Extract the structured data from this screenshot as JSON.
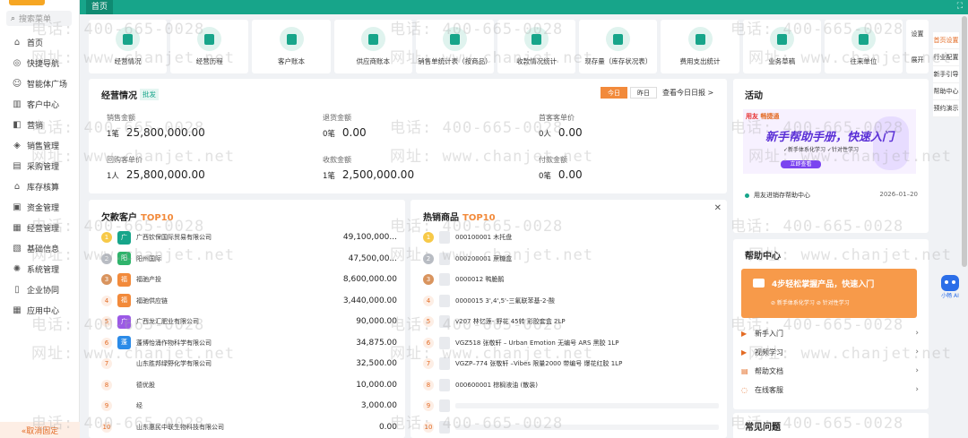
{
  "sidebar": {
    "search_placeholder": "搜索菜单",
    "items": [
      {
        "label": "首页",
        "icon": "home-icon"
      },
      {
        "label": "快捷导航",
        "icon": "compass-icon"
      },
      {
        "label": "智能体广场",
        "icon": "robot-icon"
      },
      {
        "label": "客户中心",
        "icon": "book-icon"
      },
      {
        "label": "营销",
        "icon": "megaphone-icon"
      },
      {
        "label": "销售管理",
        "icon": "tag-icon"
      },
      {
        "label": "采购管理",
        "icon": "cart-icon"
      },
      {
        "label": "库存核算",
        "icon": "warehouse-icon"
      },
      {
        "label": "资金管理",
        "icon": "wallet-icon"
      },
      {
        "label": "经营管理",
        "icon": "chart-icon"
      },
      {
        "label": "基础信息",
        "icon": "id-card-icon"
      },
      {
        "label": "系统管理",
        "icon": "gear-icon"
      },
      {
        "label": "企业协同",
        "icon": "doc-icon"
      },
      {
        "label": "应用中心",
        "icon": "calendar-icon"
      }
    ],
    "cancel_fix": "«取消固定"
  },
  "topbar": {
    "tab_home": "首页",
    "fullscreen_icon": "expand-icon"
  },
  "tiles": [
    "经营情况",
    "经营历程",
    "客户账本",
    "供应商账本",
    "销售单统计表（按商品）",
    "收款情况统计",
    "现存量（库存状况表）",
    "费用支出统计",
    "业务草稿",
    "往来单位"
  ],
  "tile_side": {
    "settings": "设置",
    "expand": "展开"
  },
  "rail": [
    "首页设置",
    "行业配置",
    "新手引导",
    "帮助中心",
    "预约演示"
  ],
  "assistant": "小畅 AI",
  "business": {
    "title": "经营情况",
    "tag": "批发",
    "btn_today": "今日",
    "btn_yesterday": "昨日",
    "link": "查看今日日报 >",
    "stats": [
      {
        "key": "销售金额",
        "count": "1笔",
        "value": "25,800,000.00"
      },
      {
        "key": "退货金额",
        "count": "0笔",
        "value": "0.00"
      },
      {
        "key": "首客客单价",
        "count": "0人",
        "value": "0.00"
      },
      {
        "key": "回购客单价",
        "count": "1人",
        "value": "25,800,000.00"
      },
      {
        "key": "收款金额",
        "count": "1笔",
        "value": "2,500,000.00"
      },
      {
        "key": "付款金额",
        "count": "0笔",
        "value": "0.00"
      }
    ]
  },
  "debt": {
    "title": "欠款客户",
    "top": "TOP10",
    "rows": [
      {
        "rank": "1",
        "avatar": "广",
        "color": "#17a58a",
        "name": "广西钦保国际贸易有限公司",
        "amount": "49,100,000..."
      },
      {
        "rank": "2",
        "avatar": "阳",
        "color": "#2fb36b",
        "name": "阳州国际",
        "amount": "47,500,00..."
      },
      {
        "rank": "3",
        "avatar": "福",
        "color": "#f28a3b",
        "name": "福驰产投",
        "amount": "8,600,000.00"
      },
      {
        "rank": "4",
        "avatar": "福",
        "color": "#f28a3b",
        "name": "福驰供应链",
        "amount": "3,440,000.00"
      },
      {
        "rank": "5",
        "avatar": "广",
        "color": "#9b59e6",
        "name": "广西龙汇肥业有限公司",
        "amount": "90,000.00"
      },
      {
        "rank": "6",
        "avatar": "蓬",
        "color": "#2b8be8",
        "name": "蓬博怡涌作物科学有限公司",
        "amount": "34,875.00"
      },
      {
        "rank": "7",
        "avatar": "",
        "color": "",
        "name": "山东胜邦绿野化学有限公司",
        "amount": "32,500.00"
      },
      {
        "rank": "8",
        "avatar": "",
        "color": "",
        "name": "德优股",
        "amount": "10,000.00"
      },
      {
        "rank": "9",
        "avatar": "",
        "color": "",
        "name": "经",
        "amount": "3,000.00"
      },
      {
        "rank": "10",
        "avatar": "",
        "color": "",
        "name": "山东惠民中联生物科技有限公司",
        "amount": "0.00"
      }
    ]
  },
  "hot": {
    "title": "热销商品",
    "top": "TOP10",
    "rows": [
      {
        "rank": "1",
        "name": "000100001 木托盘"
      },
      {
        "rank": "2",
        "name": "000200001 蔗糖盒"
      },
      {
        "rank": "3",
        "name": "0000012 鸭脆鹅"
      },
      {
        "rank": "4",
        "name": "0000015 3',4',5'-三氟联苯基-2-酸"
      },
      {
        "rank": "5",
        "name": "v207 林忆莲- 野花 45转 彩胶套盒 2LP"
      },
      {
        "rank": "6",
        "name": "VGZ518 张敬轩 – Urban Emotion 无编号 ARS 黑胶 1LP"
      },
      {
        "rank": "7",
        "name": "VGZP–774 张敬轩 –Vibes 限量2000 带编号 爆花红胶 1LP"
      },
      {
        "rank": "8",
        "name": "000600001 棕榈液油 (散装)"
      },
      {
        "rank": "9",
        "name": ""
      },
      {
        "rank": "10",
        "name": ""
      }
    ]
  },
  "activity": {
    "title": "活动",
    "banner_brand_a": "用友",
    "banner_brand_b": "畅捷通",
    "banner_title": "新手帮助手册，快速入门",
    "banner_sub": "✓新手体系化学习  ✓针对性学习",
    "banner_cta": "立即查看",
    "item": "用友进销存帮助中心",
    "date": "2026–01–20"
  },
  "help": {
    "title": "帮助中心",
    "banner_title": "4步轻松掌握产品，快速入门",
    "banner_sub": "⊘ 新手体系化学习   ⊘ 针对性学习",
    "rows": [
      "新手入门",
      "视频学习",
      "帮助文档",
      "在线客服"
    ]
  },
  "faq": {
    "title": "常见问题"
  },
  "watermark": {
    "phone": "电话: 400-665-0028",
    "site": "网址: www.chanjet.net"
  }
}
